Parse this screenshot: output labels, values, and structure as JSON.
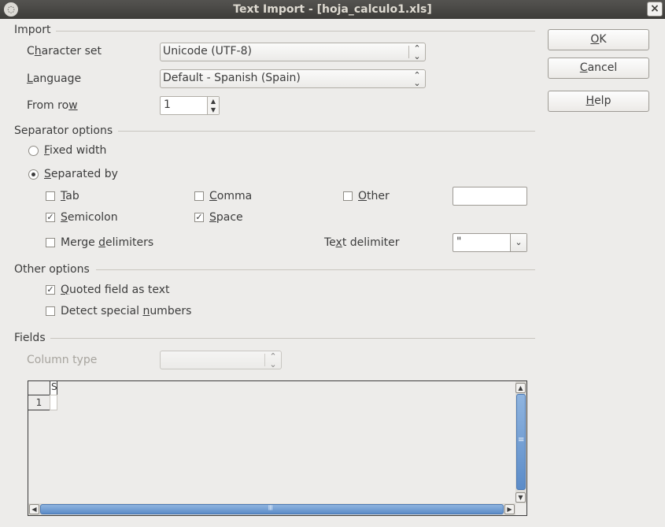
{
  "window": {
    "title": "Text Import - [hoja_calculo1.xls]",
    "close_glyph": "×"
  },
  "import_section": {
    "title": "Import",
    "charset_label_pre": "C",
    "charset_label_u": "h",
    "charset_label_post": "aracter set",
    "charset_value": "Unicode (UTF-8)",
    "language_label_pre": "",
    "language_label_u": "L",
    "language_label_post": "anguage",
    "language_value": "Default - Spanish (Spain)",
    "fromrow_label_pre": "From ro",
    "fromrow_label_u": "w",
    "fromrow_label_post": "",
    "fromrow_value": "1"
  },
  "separator_section": {
    "title": "Separator options",
    "fixed_width_u": "F",
    "fixed_width_rest": "ixed width",
    "fixed_width_selected": false,
    "separated_by_u": "S",
    "separated_by_rest": "eparated by",
    "separated_by_selected": true,
    "tab": {
      "u": "T",
      "rest": "ab",
      "checked": false
    },
    "comma": {
      "u": "C",
      "rest": "omma",
      "checked": false
    },
    "other": {
      "u": "O",
      "rest": "ther",
      "checked": false,
      "value": ""
    },
    "semicolon": {
      "u": "S",
      "rest": "emicolon",
      "checked": true
    },
    "space": {
      "u": "S",
      "rest": "pace",
      "checked": true
    },
    "merge": {
      "pre": "Merge ",
      "u": "d",
      "rest": "elimiters",
      "checked": false
    },
    "text_delim_pre": "Te",
    "text_delim_u": "x",
    "text_delim_post": "t delimiter",
    "text_delim_value": "\""
  },
  "other_section": {
    "title": "Other options",
    "quoted": {
      "u": "Q",
      "rest": "uoted field as text",
      "checked": true
    },
    "detect": {
      "pre": "Detect special ",
      "u": "n",
      "rest": "umbers",
      "checked": false
    }
  },
  "fields_section": {
    "title": "Fields",
    "column_type_label": "Column type",
    "column_type_value": "",
    "grid": {
      "header_col": "S",
      "row_number": "1"
    }
  },
  "buttons": {
    "ok_u": "O",
    "ok_rest": "K",
    "cancel_u": "C",
    "cancel_rest": "ancel",
    "help_u": "H",
    "help_rest": "elp"
  },
  "check_glyph": "✓",
  "scroll": {
    "up": "▲",
    "down": "▼",
    "left": "◀",
    "right": "▶",
    "grip": "≡"
  }
}
